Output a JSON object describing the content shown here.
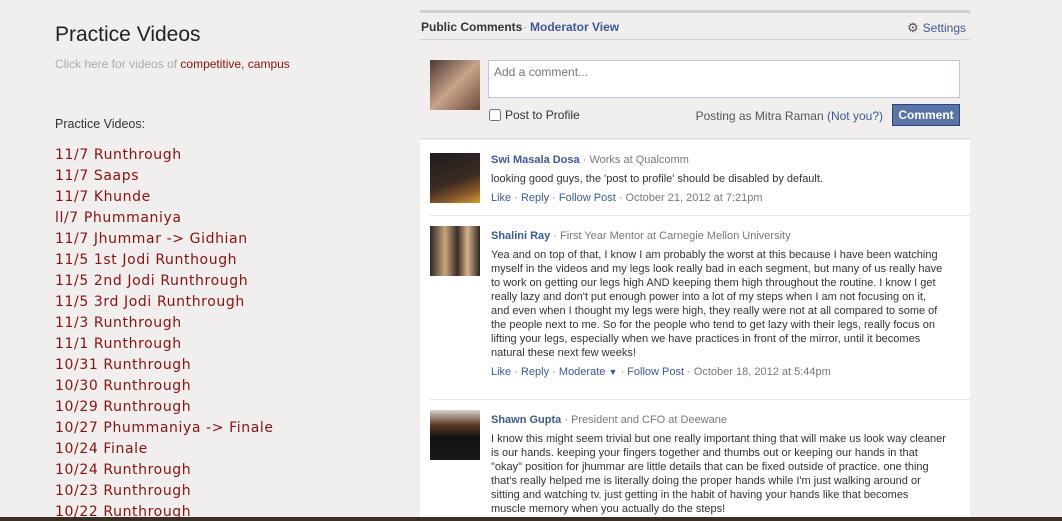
{
  "left": {
    "title": "Practice Videos",
    "subtitle_prefix": "Click here for videos of",
    "subtitle_link1": "competitive,",
    "subtitle_link2": "campus",
    "list_heading": "Practice Videos:",
    "videos": [
      "11/7 Runthrough",
      "11/7 Saaps",
      "11/7 Khunde",
      "ll/7 Phummaniya",
      "11/7 Jhummar -> Gidhian",
      "11/5 1st Jodi Runthough",
      "11/5 2nd Jodi Runthrough",
      "11/5 3rd Jodi Runthrough",
      "11/3 Runthrough",
      "11/1 Runthrough",
      "10/31 Runthrough",
      "10/30 Runthrough",
      "10/29 Runthrough",
      "10/27 Phummaniya -> Finale",
      "10/24 Finale",
      "10/24 Runthrough",
      "10/23 Runthrough",
      "10/22 Runthrough"
    ]
  },
  "panel": {
    "tab_public": "Public Comments",
    "tab_separator": "·",
    "tab_moderator": "Moderator View",
    "settings": "Settings",
    "composer": {
      "placeholder": "Add a comment...",
      "post_to_profile": "Post to Profile",
      "posting_as": "Posting as Mitra Raman",
      "not_you": "(Not you?)",
      "button": "Comment"
    },
    "comments": [
      {
        "name": "Swi Masala Dosa",
        "meta": "· Works at Qualcomm",
        "text": "looking good guys, the 'post to profile' should be disabled by default.",
        "like": "Like",
        "reply": "Reply",
        "follow": "Follow Post",
        "sep": "·",
        "date": "· October 21, 2012 at 7:21pm"
      },
      {
        "name": "Shalini Ray",
        "meta": "· First Year Mentor at Carnegie Mellon University",
        "text": "Yea and on top of that, I know I am probably the worst at this because I have been watching myself in the videos and my legs look really bad in each segment, but many of us really have to work on getting our legs high AND keeping them high throughout the routine. I know I get really lazy and don't put enough power into a lot of my steps when I am not focusing on it, and even when I thought my legs were high, they really were not at all compared to some of the people next to me. So for the people who tend to get lazy with their legs, really focus on lifting your legs, especially when we have practices in front of the mirror, until it becomes natural these next few weeks!",
        "like": "Like",
        "reply": "Reply",
        "moderate": "Moderate",
        "follow": "Follow Post",
        "sep": "·",
        "date": "· October 18, 2012 at 5:44pm"
      },
      {
        "name": "Shawn Gupta",
        "meta": "· President and CFO at Deewane",
        "text": "I know this might seem trivial but one really important thing that will make us look way cleaner is our hands. keeping your fingers together and thumbs out or keeping our hands in that \"okay\" position for jhummar are little details that can be fixed outside of practice. one thing that's really helped me is literally doing the proper hands while I'm just walking around or sitting and watching tv. just getting in the habit of having your hands like that becomes muscle memory when you actually do the steps!"
      }
    ]
  },
  "colors": {
    "link_red": "#8b1010",
    "fb_blue": "#3b5998",
    "button_blue": "#5b74a8",
    "background": "#f0efed"
  }
}
